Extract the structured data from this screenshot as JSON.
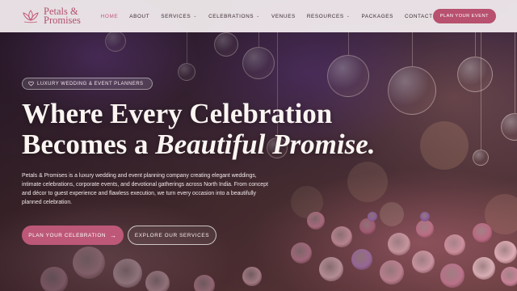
{
  "brand": {
    "name_line1": "Petals &",
    "name_line2": "Promises",
    "accent": "#b8506f"
  },
  "nav": {
    "links": [
      {
        "label": "Home",
        "active": true,
        "dropdown": false
      },
      {
        "label": "About",
        "active": false,
        "dropdown": false
      },
      {
        "label": "Services",
        "active": false,
        "dropdown": true
      },
      {
        "label": "Celebrations",
        "active": false,
        "dropdown": true
      },
      {
        "label": "Venues",
        "active": false,
        "dropdown": false
      },
      {
        "label": "Resources",
        "active": false,
        "dropdown": true
      },
      {
        "label": "Packages",
        "active": false,
        "dropdown": false
      },
      {
        "label": "Contact",
        "active": false,
        "dropdown": false
      }
    ],
    "cta_label": "Plan Your Event"
  },
  "hero": {
    "badge_label": "Luxury Wedding & Event Planners",
    "badge_icon": "heart-icon",
    "headline_line1": "Where Every Celebration",
    "headline_line2_plain": "Becomes a",
    "headline_line2_italic": "Beautiful Promise.",
    "intro": "Petals & Promises is a luxury wedding and event planning company creating elegant weddings, intimate celebrations, corporate events, and devotional gatherings across North India. From concept and décor to guest experience and flawless execution, we turn every occasion into a beautifully planned celebration.",
    "primary_button": "Plan Your Celebration",
    "primary_arrow": "→",
    "secondary_button": "Explore Our Services"
  }
}
